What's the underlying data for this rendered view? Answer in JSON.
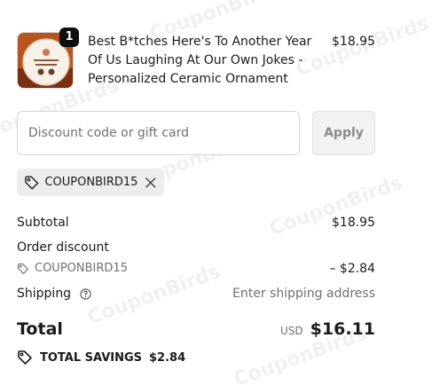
{
  "watermark": "CouponBirds",
  "product": {
    "quantity": "1",
    "title": "Best B*tches Here's To Another Year Of Us Laughing At Our Own Jokes - Personalized Ceramic Ornament",
    "price": "$18.95"
  },
  "discount": {
    "placeholder": "Discount code or gift card",
    "apply_label": "Apply",
    "applied_code": "COUPONBIRD15"
  },
  "summary": {
    "subtotal_label": "Subtotal",
    "subtotal_value": "$18.95",
    "order_discount_label": "Order discount",
    "order_discount_code": "COUPONBIRD15",
    "order_discount_value": "– $2.84",
    "shipping_label": "Shipping",
    "shipping_value": "Enter shipping address",
    "total_label": "Total",
    "currency": "USD",
    "total_value": "$16.11",
    "savings_label": "TOTAL SAVINGS",
    "savings_value": "$2.84"
  },
  "icons": {
    "tag": "tag-icon",
    "close": "close-icon",
    "help": "help-icon"
  },
  "colors": {
    "text": "#1a1a1a",
    "muted": "#707070",
    "badge": "#0f0f0f",
    "chip_bg": "#ededed"
  }
}
